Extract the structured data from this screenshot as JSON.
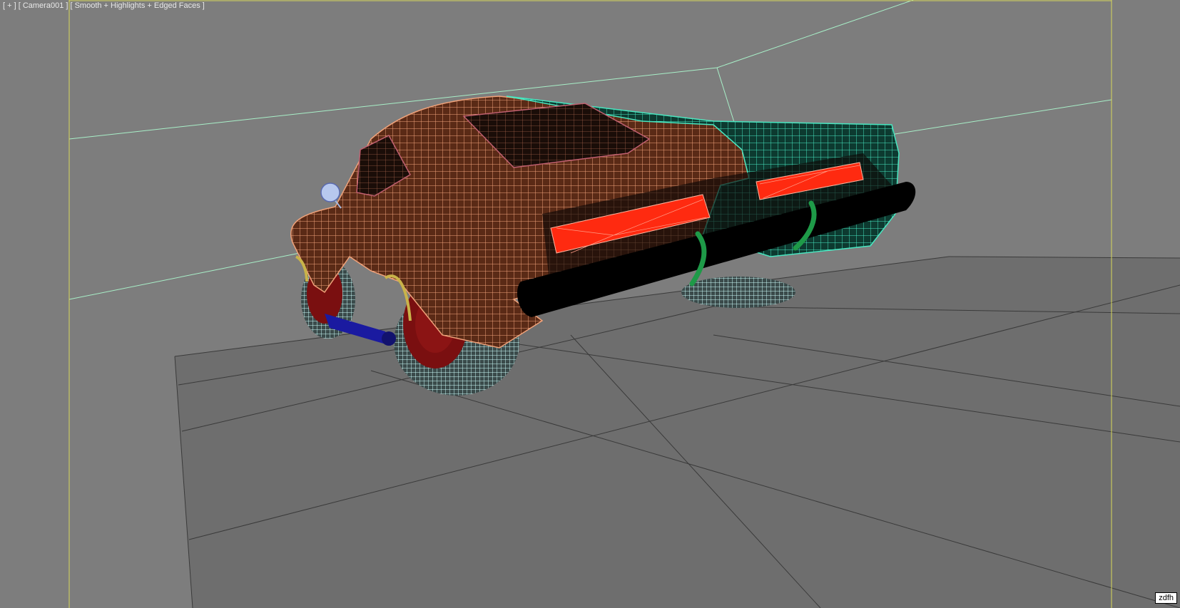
{
  "viewport": {
    "label_view": "[ + ]",
    "label_camera": "[ Camera001 ]",
    "label_shading": "[ Smooth + Highlights + Edged Faces ]",
    "badge_text": "zdfh"
  },
  "colors": {
    "background": "#7d7d7d",
    "frame": "#d8d85a",
    "wall_edges": "#a8f0c8",
    "floor_edges": "#3a3a3a",
    "body_orange": "#e8916a",
    "body_teal": "#3fe0b8",
    "tail_light": "#ff2a10",
    "bumper": "#000000",
    "wheel_rim": "#7a0f10",
    "tire_wire": "#bff6f4",
    "exhaust": "#1a1aa0",
    "hanger_green": "#1e9a48"
  }
}
